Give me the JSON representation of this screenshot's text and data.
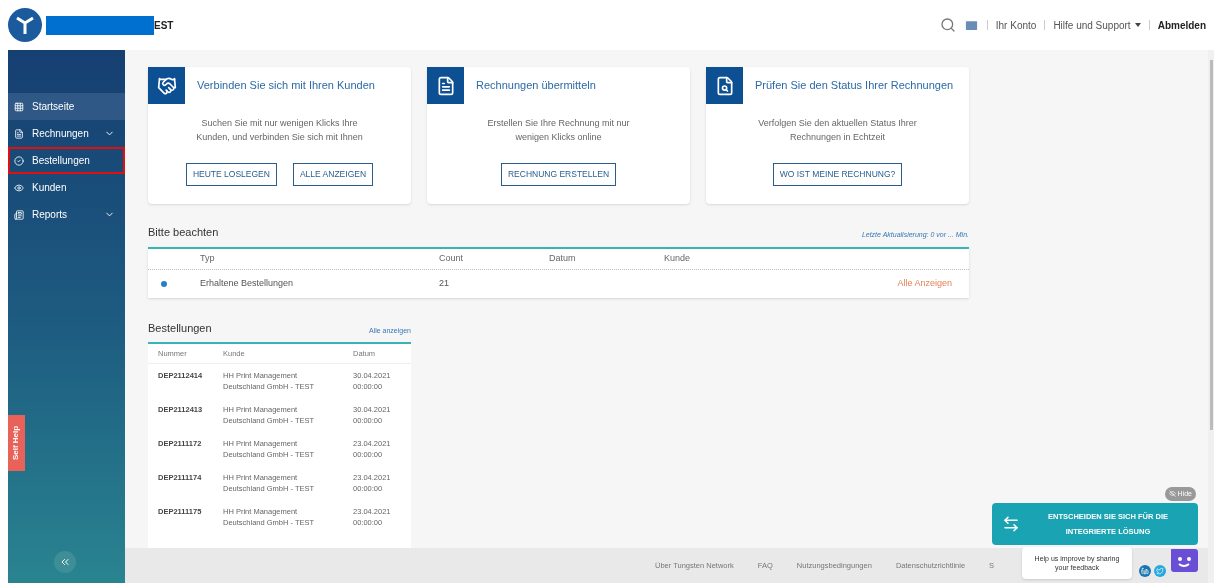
{
  "header": {
    "brand_suffix": "EST",
    "links": [
      {
        "kind": "link",
        "label": "Ihr Konto"
      },
      {
        "kind": "dropdown",
        "label": "Hilfe und Support"
      },
      {
        "kind": "bold",
        "label": "Abmelden"
      }
    ]
  },
  "sidebar": {
    "items": [
      {
        "label": "Startseite",
        "selected": true,
        "outlined": false,
        "expandable": false
      },
      {
        "label": "Rechnungen",
        "selected": false,
        "outlined": false,
        "expandable": true
      },
      {
        "label": "Bestellungen",
        "selected": false,
        "outlined": true,
        "expandable": false
      },
      {
        "label": "Kunden",
        "selected": false,
        "outlined": false,
        "expandable": false
      },
      {
        "label": "Reports",
        "selected": false,
        "outlined": false,
        "expandable": true
      }
    ],
    "self_help": "Self Help"
  },
  "cards": [
    {
      "title": "Verbinden Sie sich mit Ihren Kunden",
      "text": "Suchen Sie mit nur wenigen Klicks Ihre Kunden, und verbinden Sie sich mit Ihnen",
      "buttons": [
        "HEUTE LOSLEGEN",
        "ALLE ANZEIGEN"
      ]
    },
    {
      "title": "Rechnungen übermitteln",
      "text": "Erstellen Sie Ihre Rechnung mit nur wenigen Klicks online",
      "buttons": [
        "RECHNUNG ERSTELLEN"
      ]
    },
    {
      "title": "Prüfen Sie den Status Ihrer Rechnungen",
      "text": "Verfolgen Sie den aktuellen Status Ihrer Rechnungen in Echtzeit",
      "buttons": [
        "WO IST MEINE RECHNUNG?"
      ]
    }
  ],
  "notice": {
    "title": "Bitte beachten",
    "updated": "Letzte Aktualisierung: 0 vor ... Min.",
    "columns": [
      "Typ",
      "Count",
      "Datum",
      "Kunde"
    ],
    "rows": [
      {
        "color": "#2a7fc4",
        "typ": "Erhaltene Bestellungen",
        "count": "21",
        "action": "Alle Anzeigen"
      }
    ]
  },
  "orders": {
    "title": "Bestellungen",
    "link": "Alle anzeigen",
    "columns": [
      "Nummer",
      "Kunde",
      "Datum"
    ],
    "rows": [
      {
        "nummer": "DEP2112414",
        "kunde": [
          "HH Print Management",
          "Deutschland GmbH - TEST"
        ],
        "datum": [
          "30.04.2021",
          "00:00:00"
        ]
      },
      {
        "nummer": "DEP2112413",
        "kunde": [
          "HH Print Management",
          "Deutschland GmbH - TEST"
        ],
        "datum": [
          "30.04.2021",
          "00:00:00"
        ]
      },
      {
        "nummer": "DEP2111172",
        "kunde": [
          "HH Print Management",
          "Deutschland GmbH - TEST"
        ],
        "datum": [
          "23.04.2021",
          "00:00:00"
        ]
      },
      {
        "nummer": "DEP2111174",
        "kunde": [
          "HH Print Management",
          "Deutschland GmbH - TEST"
        ],
        "datum": [
          "23.04.2021",
          "00:00:00"
        ]
      },
      {
        "nummer": "DEP2111175",
        "kunde": [
          "HH Print Management",
          "Deutschland GmbH - TEST"
        ],
        "datum": [
          "23.04.2021",
          "00:00:00"
        ]
      }
    ]
  },
  "promo": {
    "hide": "Hide",
    "text": "ENTSCHEIDEN SIE SICH FÜR DIE INTEGRIERTE LÖSUNG"
  },
  "feedback": {
    "text": "Help us improve by sharing your feedback"
  },
  "footer": {
    "links": [
      "Über Tungsten Network",
      "FAQ",
      "Nutzungsbedingungen",
      "Datenschutzrichtlinie",
      "S"
    ]
  }
}
